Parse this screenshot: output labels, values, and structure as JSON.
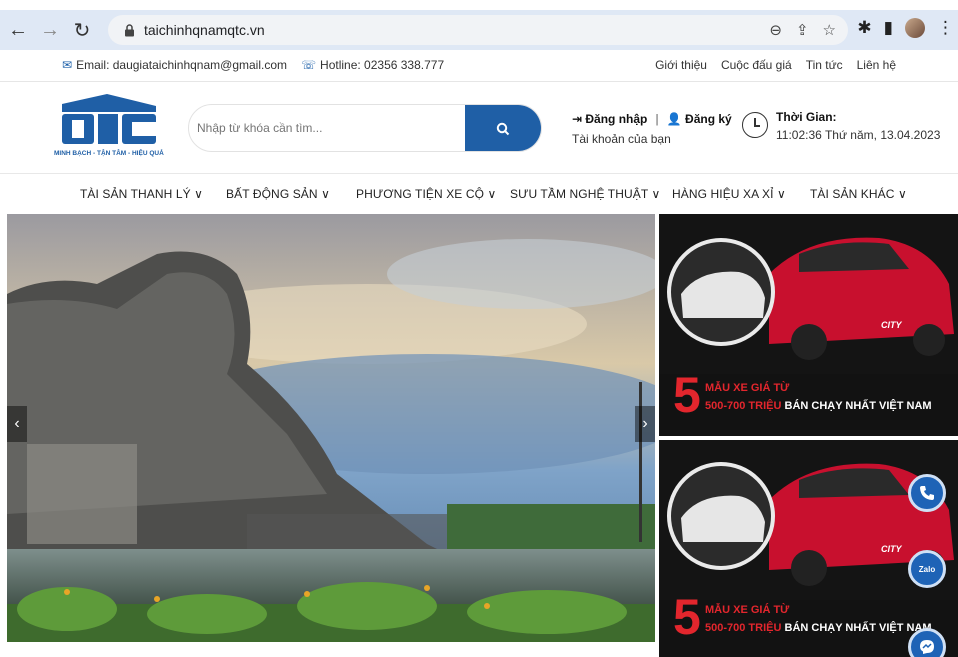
{
  "browser": {
    "url": "taichinhqnamqtc.vn"
  },
  "topbar": {
    "email": "Email: daugiataichinhqnam@gmail.com",
    "hotline": "Hotline: 02356 338.777",
    "links": [
      "Giới thiệu",
      "Cuộc đấu giá",
      "Tin tức",
      "Liên hệ"
    ]
  },
  "header": {
    "logo_text": "QTC",
    "logo_tagline": "MINH BẠCH - TẬN TÂM - HIỆU QUẢ",
    "search_placeholder": "Nhập từ khóa cần tìm...",
    "login": "Đăng nhập",
    "register": "Đăng ký",
    "account_sub": "Tài khoản của bạn",
    "time_label": "Thời Gian:",
    "time_value": "11:02:36 Thứ năm, 13.04.2023"
  },
  "nav": {
    "items": [
      "TÀI SẢN THANH LÝ ∨",
      "BẤT ĐỘNG SẢN ∨",
      "PHƯƠNG TIỆN XE CỘ ∨",
      "SƯU TẦM NGHỆ THUẬT ∨",
      "HÀNG HIỆU XA XỈ ∨",
      "TÀI SẢN KHÁC ∨"
    ]
  },
  "banners": [
    {
      "number": "5",
      "line1": "MẪU XE GIÁ TỪ",
      "line2_red": "500-700 TRIỆU",
      "line2_white": " BÁN CHẠY NHẤT VIỆT NAM",
      "model": "CITY"
    },
    {
      "number": "5",
      "line1": "MẪU XE GIÁ TỪ",
      "line2_red": "500-700 TRIỆU",
      "line2_white": " BÁN CHẠY NHẤT VIỆT NAM",
      "model": "CITY"
    }
  ],
  "float_buttons": {
    "zalo": "Zalo"
  },
  "colors": {
    "brand_blue": "#1f5fa6",
    "banner_red": "#e3262d"
  }
}
